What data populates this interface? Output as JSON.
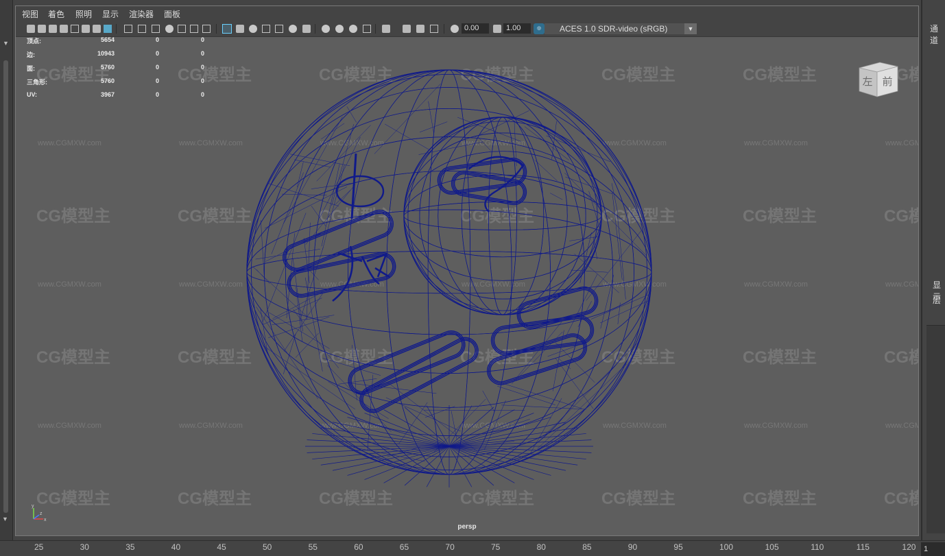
{
  "menu": [
    "视图",
    "着色",
    "照明",
    "显示",
    "渲染器",
    "面板"
  ],
  "toolbar": {
    "exposure_value": "0.00",
    "gamma_value": "1.00",
    "color_management": "ACES 1.0 SDR-video (sRGB)"
  },
  "hud": {
    "rows": [
      {
        "label": "顶点:",
        "count": "5654",
        "selected": "0",
        "uv": "0"
      },
      {
        "label": "边:",
        "count": "10943",
        "selected": "0",
        "uv": "0"
      },
      {
        "label": "面:",
        "count": "5760",
        "selected": "0",
        "uv": "0"
      },
      {
        "label": "三角形:",
        "count": "5760",
        "selected": "0",
        "uv": "0"
      },
      {
        "label": "UV:",
        "count": "3967",
        "selected": "0",
        "uv": "0"
      }
    ]
  },
  "viewcube": {
    "left_label": "左",
    "front_label": "前"
  },
  "camera_label": "persp",
  "axis": {
    "y": "y",
    "x": "x",
    "z": "z"
  },
  "watermark": {
    "brand": "CG模型主",
    "url": "www.CGMXW.com"
  },
  "wireframe_color": "#101a8a",
  "accent_color": "#5fc4f0",
  "right_panel": {
    "tab_top": "通道",
    "tab_mid": "显示",
    "tab_layer": "层"
  },
  "timeline": {
    "ticks": [
      "25",
      "30",
      "35",
      "40",
      "45",
      "50",
      "55",
      "60",
      "65",
      "70",
      "75",
      "80",
      "85",
      "90",
      "95",
      "100",
      "105",
      "110",
      "115",
      "120"
    ],
    "current_frame": "1"
  }
}
